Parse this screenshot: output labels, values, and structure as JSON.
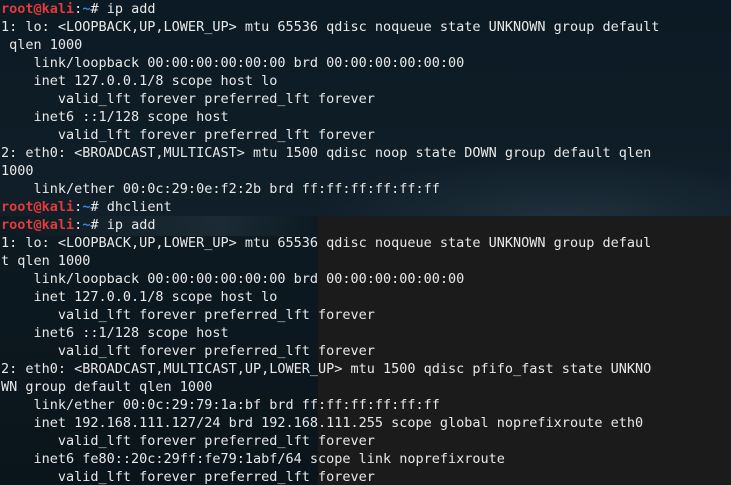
{
  "prompt": {
    "user": "root",
    "at": "@",
    "host": "kali",
    "separator": ":",
    "path": "~",
    "symbol": "# "
  },
  "colors": {
    "prompt_user": "#e23b3b",
    "prompt_path": "#3c82e0",
    "text": "#e8e8e8"
  },
  "top_terminal": {
    "lines": [
      {
        "type": "prompt",
        "cmd": "ip add"
      },
      {
        "type": "output",
        "text": "1: lo: <LOOPBACK,UP,LOWER_UP> mtu 65536 qdisc noqueue state UNKNOWN group default"
      },
      {
        "type": "output",
        "text": " qlen 1000"
      },
      {
        "type": "output",
        "text": "    link/loopback 00:00:00:00:00:00 brd 00:00:00:00:00:00"
      },
      {
        "type": "output",
        "text": "    inet 127.0.0.1/8 scope host lo"
      },
      {
        "type": "output",
        "text": "       valid_lft forever preferred_lft forever"
      },
      {
        "type": "output",
        "text": "    inet6 ::1/128 scope host"
      },
      {
        "type": "output",
        "text": "       valid_lft forever preferred_lft forever"
      },
      {
        "type": "output",
        "text": "2: eth0: <BROADCAST,MULTICAST> mtu 1500 qdisc noop state DOWN group default qlen"
      },
      {
        "type": "output",
        "text": "1000"
      },
      {
        "type": "output",
        "text": "    link/ether 00:0c:29:0e:f2:2b brd ff:ff:ff:ff:ff:ff"
      },
      {
        "type": "prompt",
        "cmd": "dhclient"
      }
    ]
  },
  "bottom_terminal": {
    "lines": [
      {
        "type": "prompt",
        "cmd": "ip add"
      },
      {
        "type": "output",
        "text": "1: lo: <LOOPBACK,UP,LOWER_UP> mtu 65536 qdisc noqueue state UNKNOWN group defaul"
      },
      {
        "type": "output",
        "text": "t qlen 1000"
      },
      {
        "type": "output",
        "text": "    link/loopback 00:00:00:00:00:00 brd 00:00:00:00:00:00"
      },
      {
        "type": "output",
        "text": "    inet 127.0.0.1/8 scope host lo"
      },
      {
        "type": "output",
        "text": "       valid_lft forever preferred_lft forever"
      },
      {
        "type": "output",
        "text": "    inet6 ::1/128 scope host"
      },
      {
        "type": "output",
        "text": "       valid_lft forever preferred_lft forever"
      },
      {
        "type": "output",
        "text": "2: eth0: <BROADCAST,MULTICAST,UP,LOWER_UP> mtu 1500 qdisc pfifo_fast state UNKNO"
      },
      {
        "type": "output",
        "text": "WN group default qlen 1000"
      },
      {
        "type": "output",
        "text": "    link/ether 00:0c:29:79:1a:bf brd ff:ff:ff:ff:ff:ff"
      },
      {
        "type": "output",
        "text": "    inet 192.168.111.127/24 brd 192.168.111.255 scope global noprefixroute eth0"
      },
      {
        "type": "output",
        "text": "       valid_lft forever preferred_lft forever"
      },
      {
        "type": "output",
        "text": "    inet6 fe80::20c:29ff:fe79:1abf/64 scope link noprefixroute"
      },
      {
        "type": "output",
        "text": "       valid_lft forever preferred_lft forever"
      }
    ]
  }
}
